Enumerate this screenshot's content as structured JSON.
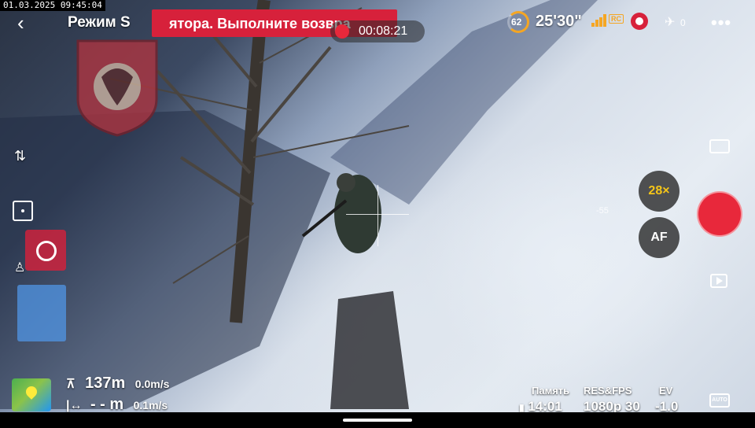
{
  "timestamp": "01.03.2025 09:45:04",
  "header": {
    "mode": "Режим S",
    "alert_text": "ятора. Выполните возвра",
    "recording_time": "00:08:21",
    "battery_percent": "62",
    "flight_time": "25'30\"",
    "rc_label": "RC",
    "satellite_count": "0",
    "more_label": "•••"
  },
  "telemetry": {
    "altitude": "137m",
    "vertical_speed": "0.0m/s",
    "distance": "- - m",
    "horizontal_speed": "0.1m/s"
  },
  "camera": {
    "zoom": "28×",
    "af_label": "AF",
    "ev_tick": "-55",
    "auto_label": "AUTO"
  },
  "stats": {
    "memory_label": "Память",
    "memory_value": "14:01",
    "res_label": "RES&FPS",
    "res_value": "1080p 30",
    "ev_label": "EV",
    "ev_value": "-1.0"
  },
  "colors": {
    "accent_red": "#e8283b",
    "alert_red": "#d7213b",
    "battery_orange": "#f5a623",
    "zoom_yellow": "#f5c518"
  },
  "icons": [
    "back-arrow-icon",
    "battery-icon",
    "signal-bars-icon",
    "video-signal-icon",
    "satellite-icon",
    "more-icon",
    "emblem-icon",
    "orientation-icon",
    "frame-icon",
    "target-icon",
    "person-icon",
    "map-icon",
    "altitude-icon",
    "distance-icon",
    "camera-mode-icon",
    "playback-icon",
    "auto-icon",
    "sd-card-icon"
  ]
}
